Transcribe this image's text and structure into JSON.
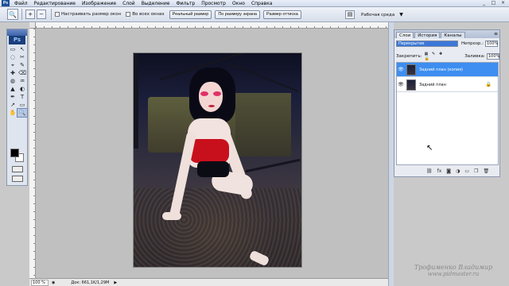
{
  "menubar": {
    "logo": "Ps",
    "items": [
      "Файл",
      "Редактирование",
      "Изображение",
      "Слой",
      "Выделение",
      "Фильтр",
      "Просмотр",
      "Окно",
      "Справка"
    ],
    "window_controls": [
      "_",
      "□",
      "×"
    ]
  },
  "options_bar": {
    "tool_icon": "zoom-icon",
    "checkbox_fit": "Настраивать размер окон",
    "checkbox_all": "Во всех окнах",
    "btn_actual": "Реальный размер",
    "btn_fit": "По размеру экрана",
    "btn_print": "Размер оттиска",
    "workspace_label": "Рабочая среда"
  },
  "toolbox": {
    "badge": "Ps",
    "tools": [
      "▭",
      "↖",
      "◌",
      "✂",
      "⌖",
      "✎",
      "✚",
      "⌫",
      "◍",
      "♒",
      "▲",
      "◐",
      "✒",
      "T",
      "↗",
      "▭",
      "✋",
      "🔍"
    ]
  },
  "statusbar": {
    "zoom": "100 %",
    "doc_info": "Док: 661,1K/1,29M"
  },
  "layers_panel": {
    "tabs": [
      "Слои",
      "История",
      "Каналы"
    ],
    "blend_mode": "Перекрытие",
    "opacity_label": "Непрозр.:",
    "opacity_value": "100%",
    "lock_label": "Закрепить:",
    "fill_label": "Заливка:",
    "fill_value": "100%",
    "layers": [
      {
        "name": "Задний план (копия)",
        "selected": true
      },
      {
        "name": "Задний план",
        "selected": false
      }
    ],
    "footer_icons": [
      "link-icon",
      "fx-icon",
      "mask-icon",
      "adjustment-icon",
      "group-icon",
      "new-layer-icon",
      "trash-icon"
    ]
  },
  "watermark": {
    "line1": "Трофименко Владимир",
    "line2": "www.pidmaster.ru"
  }
}
